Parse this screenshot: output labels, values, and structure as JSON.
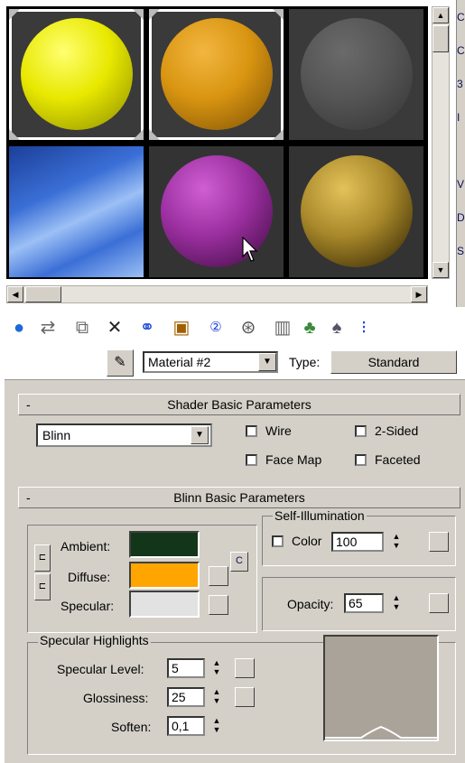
{
  "slots": [
    {
      "name": "yellow",
      "color": "#e8e800",
      "highlight": "#ffff70",
      "shadow": "#8a8a00",
      "bg": "#3a3a3a",
      "selected": true
    },
    {
      "name": "orange",
      "color": "#d99511",
      "highlight": "#f2b640",
      "shadow": "#7a4f05",
      "bg": "#3a3a3a",
      "selected": true
    },
    {
      "name": "gray",
      "color": "#555555",
      "highlight": "#6a6a6a",
      "shadow": "#333333",
      "bg": "#3a3a3a",
      "selected": false
    },
    {
      "name": "sky",
      "color": "#3b6fd6",
      "highlight": "#9cc0f5",
      "shadow": "#1b3f9a",
      "bg": "#2f5fc4",
      "selected": false,
      "flat": true
    },
    {
      "name": "purple",
      "color": "#9b2fa0",
      "highlight": "#cf5fd3",
      "shadow": "#3a0a3c",
      "bg": "#333333",
      "selected": false
    },
    {
      "name": "olive",
      "color": "#a8882a",
      "highlight": "#e3c25a",
      "shadow": "#2a1e00",
      "bg": "#333333",
      "selected": false
    }
  ],
  "sidebar_tabs": [
    "C",
    "C",
    "3",
    "I",
    "",
    "V",
    "D",
    "S"
  ],
  "toolbar": {
    "icons": [
      "get-material-icon",
      "put-to-scene-icon",
      "assign-to-selection-icon",
      "delete-icon",
      "make-unique-icon",
      "put-to-library-icon",
      "material-id-channel-icon",
      "show-map-icon",
      "show-end-result-icon",
      "go-to-parent-icon",
      "go-forward-icon",
      "select-by-material-icon"
    ]
  },
  "material": {
    "name": "Material #2",
    "type_label": "Type:",
    "type_value": "Standard"
  },
  "shader": {
    "header": "Shader Basic Parameters",
    "collapse": "-",
    "selected": "Blinn",
    "wire": "Wire",
    "two_sided": "2-Sided",
    "face_map": "Face Map",
    "faceted": "Faceted"
  },
  "blinn": {
    "header": "Blinn Basic Parameters",
    "collapse": "-",
    "ambient": {
      "label": "Ambient:",
      "color": "#13361a"
    },
    "diffuse": {
      "label": "Diffuse:",
      "color": "#ffa500"
    },
    "specular": {
      "label": "Specular:",
      "color": "#e2e2e2"
    },
    "lock": "C",
    "self_illum": {
      "title": "Self-Illumination",
      "color_label": "Color",
      "value": "100"
    },
    "opacity": {
      "label": "Opacity:",
      "value": "65"
    }
  },
  "highlights": {
    "title": "Specular Highlights",
    "level": {
      "label": "Specular Level:",
      "value": "5"
    },
    "gloss": {
      "label": "Glossiness:",
      "value": "25"
    },
    "soften": {
      "label": "Soften:",
      "value": "0,1"
    },
    "curve_color": "#a9a39a"
  }
}
